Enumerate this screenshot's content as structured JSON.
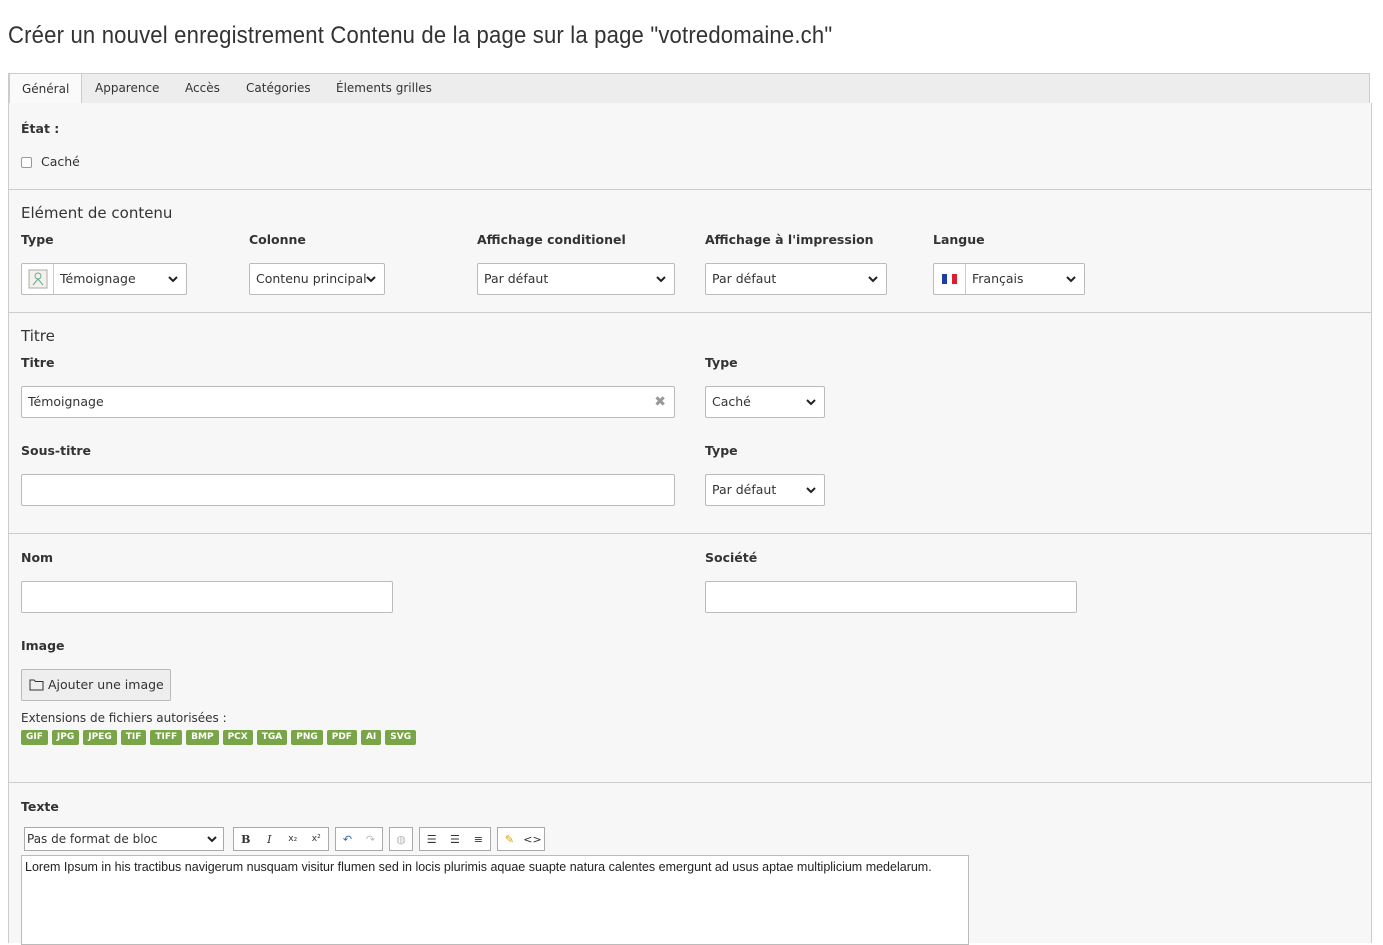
{
  "page_title": "Créer un nouvel enregistrement Contenu de la page sur la page \"votredomaine.ch\"",
  "tabs": [
    {
      "label": "Général",
      "active": true
    },
    {
      "label": "Apparence"
    },
    {
      "label": "Accès"
    },
    {
      "label": "Catégories"
    },
    {
      "label": "Élements grilles"
    }
  ],
  "state": {
    "label": "État :",
    "hidden_label": "Caché"
  },
  "content_element": {
    "section_title": "Elément de contenu",
    "type_label": "Type",
    "type_value": "Témoignage",
    "column_label": "Colonne",
    "column_value": "Contenu principal",
    "conditional_label": "Affichage conditionel",
    "conditional_value": "Par défaut",
    "print_label": "Affichage à l'impression",
    "print_value": "Par défaut",
    "language_label": "Langue",
    "language_value": "Français"
  },
  "title_section": {
    "section_title": "Titre",
    "title_label": "Titre",
    "title_value": "Témoignage",
    "title_type_label": "Type",
    "title_type_value": "Caché",
    "subtitle_label": "Sous-titre",
    "subtitle_value": "",
    "subtitle_type_label": "Type",
    "subtitle_type_value": "Par défaut"
  },
  "person": {
    "name_label": "Nom",
    "name_value": "",
    "company_label": "Société",
    "company_value": "",
    "image_label": "Image",
    "add_image_button": "Ajouter une image",
    "extensions_label": "Extensions de fichiers autorisées :",
    "extensions": [
      "GIF",
      "JPG",
      "JPEG",
      "TIF",
      "TIFF",
      "BMP",
      "PCX",
      "TGA",
      "PNG",
      "PDF",
      "AI",
      "SVG"
    ]
  },
  "text_section": {
    "label": "Texte",
    "block_format": "Pas de format de bloc",
    "content": "Lorem Ipsum in his tractibus navigerum nusquam visitur flumen sed in locis plurimis aquae suapte natura calentes emergunt ad usus aptae multiplicium medelarum."
  },
  "colors": {
    "extension_badge": "#79a548",
    "panel_bg": "#f7f7f7",
    "tab_bar_bg": "#ededed"
  }
}
